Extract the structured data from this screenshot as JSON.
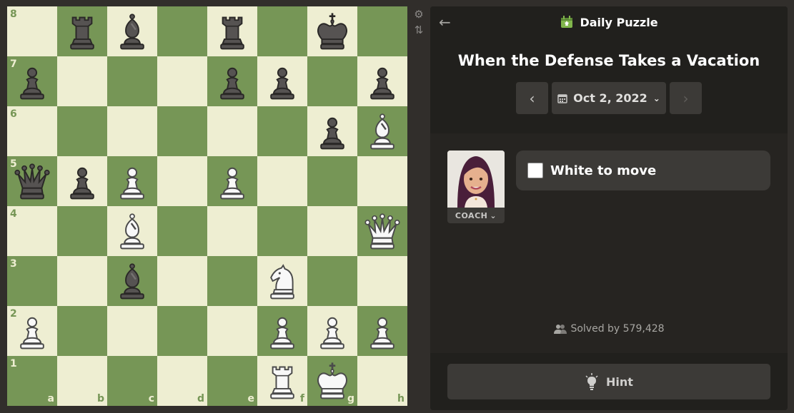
{
  "header": {
    "icon": "daily-puzzle-icon",
    "title": "Daily Puzzle"
  },
  "puzzle": {
    "title": "When the Defense Takes a Vacation",
    "date": "Oct 2, 2022"
  },
  "coach": {
    "label": "COACH",
    "message": "White to move"
  },
  "stats": {
    "solved": "Solved by 579,428"
  },
  "hint": {
    "label": "Hint"
  },
  "board": {
    "light_color": "#eeeed2",
    "dark_color": "#769656",
    "ranks": [
      "8",
      "7",
      "6",
      "5",
      "4",
      "3",
      "2",
      "1"
    ],
    "files": [
      "a",
      "b",
      "c",
      "d",
      "e",
      "f",
      "g",
      "h"
    ],
    "rows": [
      [
        "",
        "br",
        "bb",
        "",
        "br",
        "",
        "bk",
        ""
      ],
      [
        "bp",
        "",
        "",
        "",
        "bp",
        "bp",
        "",
        "bp"
      ],
      [
        "",
        "",
        "",
        "",
        "",
        "",
        "bp",
        "wb"
      ],
      [
        "bq",
        "bp",
        "wp",
        "",
        "wp",
        "",
        "",
        ""
      ],
      [
        "",
        "",
        "wb",
        "",
        "",
        "",
        "",
        "wq"
      ],
      [
        "",
        "",
        "bb",
        "",
        "",
        "wn",
        "",
        ""
      ],
      [
        "wp",
        "",
        "",
        "",
        "",
        "wp",
        "wp",
        "wp"
      ],
      [
        "",
        "",
        "",
        "",
        "",
        "wr",
        "wk",
        ""
      ]
    ]
  }
}
